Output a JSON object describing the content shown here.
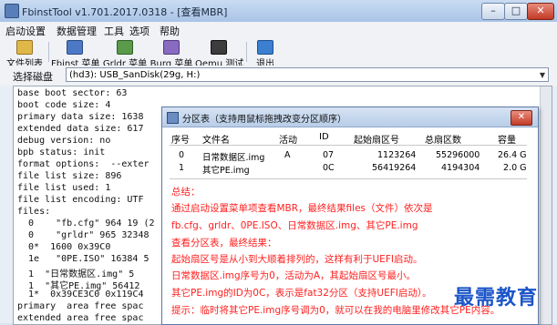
{
  "window": {
    "title": "FbinstTool v1.701.2017.0318 - [查看MBR]"
  },
  "controls": {
    "minimize": "–",
    "maximize": "□",
    "close": "✕"
  },
  "menu": [
    "启动设置",
    "数据管理",
    "工具",
    "选项",
    "帮助"
  ],
  "toolbar": {
    "file_list": "文件列表",
    "fbinst_menu": "Fbinst 菜单",
    "grldr_menu": "Grldr 菜单",
    "burg_menu": "Burg 菜单",
    "qemu_test": "Qemu 测试",
    "exit": "退出"
  },
  "disk": {
    "label": "选择磁盘",
    "value": "(hd3): USB_SanDisk(29g, H:)"
  },
  "textpane": {
    "lines": [
      "base boot sector: 63",
      "boot code size: 4",
      "primary data size: 1638",
      "extended data size: 617",
      "debug version: no",
      "bpb status: init",
      "format options:  --exter",
      "file list size: 896",
      "file list used: 1",
      "file list encoding: UTF",
      "files:",
      "  0    \"fb.cfg\" 964 19 (2",
      "  0    \"grldr\" 965 32348",
      "  0*  1600 0x39C0",
      "  1e   \"0PE.ISO\" 16384 5",
      "  1  \"日常数据区.img\" 5",
      "  1  \"其它PE.img\" 56412",
      "  1*  0x39CE3C0 0x119C4",
      "primary  area free spac",
      "extended area free spac"
    ]
  },
  "dialog": {
    "title": "分区表（支持用鼠标拖拽改变分区顺序）",
    "headers": [
      "序号",
      "文件名",
      "活动",
      "ID",
      "起始扇区号",
      "总扇区数",
      "容量"
    ],
    "rows": [
      [
        "0",
        "日常数据区.img",
        "A",
        "07",
        "1123264",
        "55296000",
        "26.4 G"
      ],
      [
        "1",
        "其它PE.img",
        "",
        "0C",
        "56419264",
        "4194304",
        "2.0 G"
      ]
    ],
    "notes": {
      "title": "总结：",
      "lines": [
        "通过启动设置菜单项查看MBR，最终结果files（文件）依次是",
        "fb.cfg、grldr、0PE.ISO、日常数据区.img、其它PE.img",
        "查看分区表，最终结果：",
        "起始扇区号是从小到大顺着排列的，这样有利于UEFI启动。",
        "日常数据区.img序号为0，活动为A，其起始扇区号最小。",
        "其它PE.img的ID为0C，表示是fat32分区（支持UEFI启动）。",
        "提示：临时将其它PE.img序号调为0，就可以在我的电脑里修改其它PE内容。"
      ]
    }
  },
  "watermark": "最需教育"
}
